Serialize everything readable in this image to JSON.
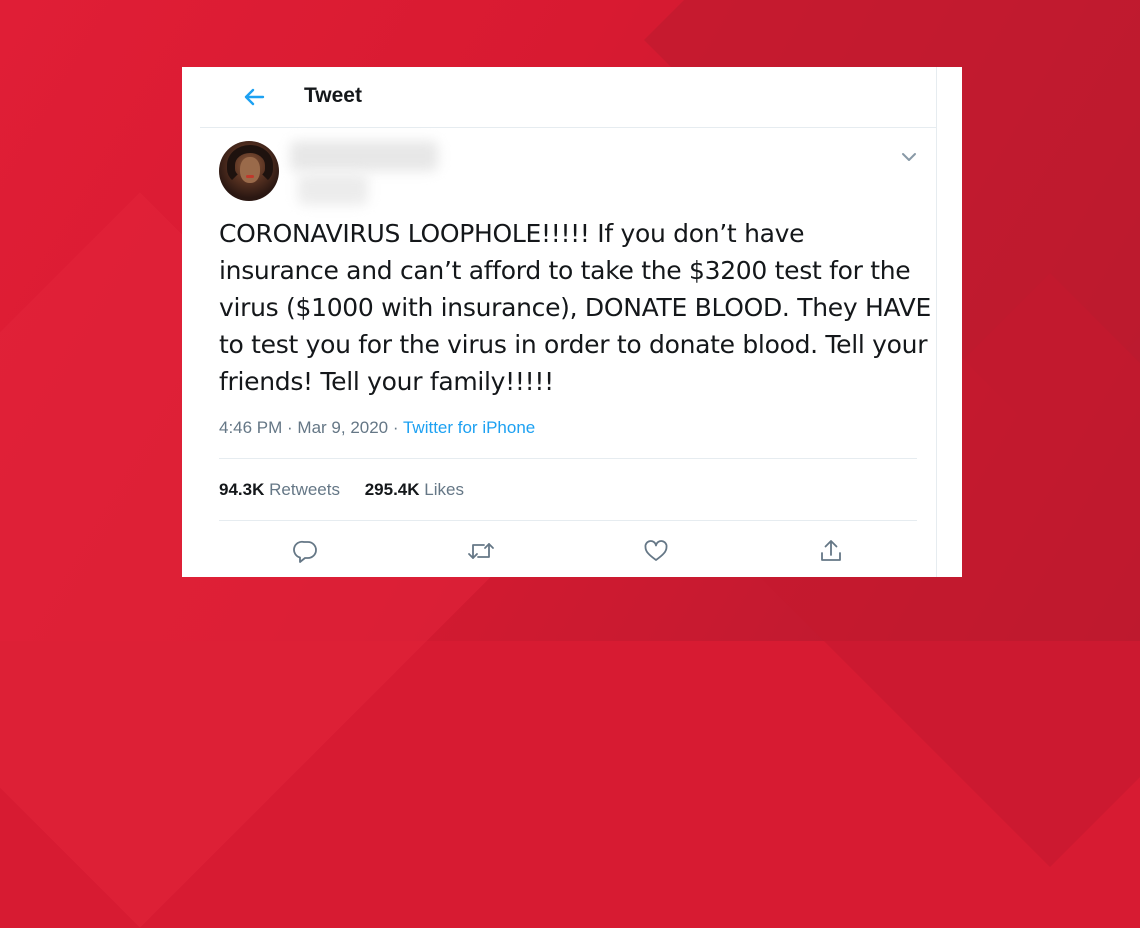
{
  "header": {
    "title": "Tweet",
    "back_icon": "arrow-left-icon"
  },
  "tweet": {
    "text": "CORONAVIRUS LOOPHOLE!!!!! If you don’t have insurance and can’t afford to take the $3200 test for the virus ($1000 with insurance), DONATE BLOOD. They HAVE to test you for the virus in order to donate blood. Tell your friends! Tell your family!!!!!",
    "time": "4:46 PM",
    "date": "Mar 9, 2020",
    "source": "Twitter for iPhone",
    "separator": " · "
  },
  "stats": {
    "retweets_count": "94.3K",
    "retweets_label": "Retweets",
    "likes_count": "295.4K",
    "likes_label": "Likes"
  },
  "actions": [
    "reply-icon",
    "retweet-icon",
    "like-icon",
    "share-icon"
  ],
  "colors": {
    "background": "#d71b32",
    "accent": "#1da1f2",
    "text": "#14171a",
    "secondary_text": "#657786"
  }
}
